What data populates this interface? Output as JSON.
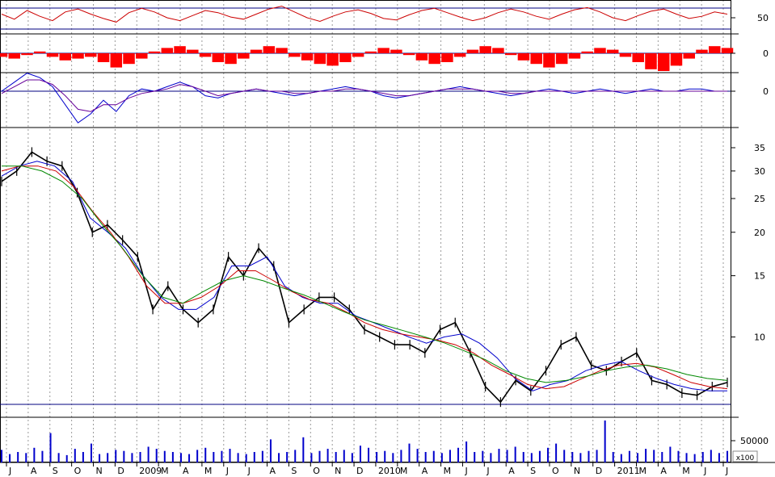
{
  "chart_data": {
    "type": "line",
    "panels": [
      {
        "name": "oscillator-rsi",
        "type": "line",
        "ticks": [
          "50"
        ],
        "series": [
          {
            "color": "#cc0000",
            "values": [
              55,
              48,
              60,
              52,
              46,
              58,
              62,
              55,
              49,
              44,
              57,
              63,
              58,
              50,
              46,
              53,
              60,
              57,
              51,
              48,
              55,
              62,
              66,
              58,
              50,
              45,
              52,
              58,
              61,
              56,
              49,
              47,
              54,
              60,
              63,
              57,
              51,
              46,
              50,
              57,
              62,
              58,
              52,
              48,
              55,
              61,
              64,
              58,
              50,
              46,
              53,
              59,
              62,
              55,
              49,
              52,
              58,
              55
            ]
          }
        ]
      },
      {
        "name": "oscillator-histogram",
        "type": "bar",
        "ticks": [
          "0"
        ],
        "series": [
          {
            "color": "#ff0000",
            "values": [
              -2,
              -3,
              -1,
              1,
              -2,
              -4,
              -3,
              -2,
              -5,
              -8,
              -6,
              -3,
              1,
              3,
              4,
              2,
              -2,
              -5,
              -6,
              -3,
              2,
              4,
              3,
              -2,
              -4,
              -6,
              -7,
              -5,
              -2,
              1,
              3,
              2,
              -1,
              -4,
              -6,
              -5,
              -2,
              2,
              4,
              3,
              -1,
              -4,
              -6,
              -8,
              -6,
              -3,
              1,
              3,
              2,
              -2,
              -5,
              -9,
              -10,
              -7,
              -3,
              2,
              4,
              3
            ]
          }
        ]
      },
      {
        "name": "oscillator-lines",
        "type": "line",
        "ticks": [
          "0"
        ],
        "series": [
          {
            "color": "#0000cc",
            "values": [
              0,
              4,
              8,
              6,
              2,
              -6,
              -14,
              -10,
              -4,
              -9,
              -2,
              1,
              0,
              2,
              4,
              2,
              -2,
              -3,
              -1,
              0,
              1,
              0,
              -1,
              -2,
              -1,
              0,
              1,
              2,
              1,
              0,
              -2,
              -3,
              -2,
              -1,
              0,
              1,
              2,
              1,
              0,
              -1,
              -2,
              -1,
              0,
              1,
              0,
              -1,
              0,
              1,
              0,
              -1,
              0,
              1,
              0,
              0,
              1,
              1,
              0,
              0
            ]
          },
          {
            "color": "#660099",
            "values": [
              -1,
              2,
              5,
              5,
              3,
              -2,
              -8,
              -9,
              -6,
              -6,
              -3,
              -1,
              0,
              1,
              3,
              2,
              0,
              -2,
              -1,
              0,
              1,
              0,
              0,
              -1,
              -1,
              0,
              0,
              1,
              1,
              0,
              -1,
              -2,
              -2,
              -1,
              0,
              1,
              1,
              1,
              0,
              0,
              -1,
              -1,
              0,
              0,
              0,
              0,
              0,
              0,
              0,
              0,
              0,
              0,
              0,
              0,
              0,
              0,
              0,
              0
            ]
          }
        ]
      },
      {
        "name": "price",
        "type": "line",
        "scale": "log",
        "ylim": [
          6.2,
          40
        ],
        "ticks": [
          "35",
          "30",
          "25",
          "20",
          "15",
          "10"
        ],
        "support_level": 6.4,
        "series": [
          {
            "color": "#000000",
            "name": "",
            "values": [
              28,
              30,
              34,
              32,
              31,
              26,
              20,
              21,
              19,
              17,
              12,
              14,
              12,
              11,
              12,
              17,
              15,
              18,
              16,
              11,
              12,
              13,
              13,
              12,
              10.5,
              10,
              9.5,
              9.5,
              9.0,
              10.5,
              11,
              9.0,
              7.2,
              6.5,
              7.5,
              7.0,
              8.0,
              9.5,
              10.0,
              8.3,
              8.0,
              8.5,
              9.0,
              7.5,
              7.3,
              6.9,
              6.8,
              7.2,
              7.4
            ]
          },
          {
            "color": "#0000cc",
            "name": "",
            "values": [
              29,
              31,
              32,
              31,
              28,
              22,
              20,
              18,
              15,
              13,
              12,
              12,
              13,
              16,
              16,
              17,
              14,
              13,
              12.5,
              12.5,
              11.5,
              11,
              10.5,
              10,
              9.6,
              10,
              10.2,
              9.6,
              8.7,
              7.6,
              7.0,
              7.3,
              7.5,
              8.0,
              8.3,
              8.5,
              8.0,
              7.6,
              7.3,
              7.1,
              7.0,
              7.0
            ]
          },
          {
            "color": "#cc0000",
            "name": "",
            "values": [
              30,
              31,
              31,
              30,
              27,
              23,
              20,
              17,
              14,
              12.5,
              12.5,
              13,
              14,
              15.5,
              15.5,
              14.5,
              13.5,
              12.8,
              12.5,
              11.8,
              11,
              10.5,
              10.2,
              10,
              9.8,
              9.5,
              9,
              8.3,
              7.8,
              7.3,
              7.1,
              7.2,
              7.6,
              8.0,
              8.3,
              8.4,
              8.2,
              7.8,
              7.4,
              7.2,
              7.1
            ]
          },
          {
            "color": "#008800",
            "name": "",
            "values": [
              31,
              31,
              30,
              28,
              25,
              21,
              18,
              15,
              13,
              12.5,
              13.5,
              14.5,
              15,
              14.5,
              13.8,
              13.2,
              12.5,
              11.8,
              11.2,
              10.8,
              10.4,
              10.0,
              9.6,
              9.1,
              8.6,
              8.0,
              7.6,
              7.4,
              7.5,
              7.7,
              8.0,
              8.2,
              8.3,
              8.1,
              7.8,
              7.6,
              7.5
            ]
          }
        ]
      },
      {
        "name": "volume",
        "type": "bar",
        "ticks": [
          "50000"
        ],
        "units_label": "x100",
        "series": [
          {
            "color": "#0000cc",
            "values": [
              12,
              8,
              10,
              9,
              14,
              11,
              28,
              9,
              7,
              13,
              10,
              18,
              8,
              9,
              12,
              11,
              9,
              10,
              15,
              13,
              11,
              10,
              9,
              8,
              12,
              14,
              10,
              11,
              13,
              9,
              8,
              10,
              11,
              22,
              9,
              10,
              12,
              24,
              9,
              11,
              13,
              10,
              12,
              9,
              16,
              14,
              10,
              11,
              9,
              12,
              18,
              13,
              10,
              11,
              9,
              12,
              14,
              20,
              10,
              11,
              9,
              13,
              12,
              15,
              10,
              9,
              11,
              14,
              18,
              12,
              10,
              9,
              11,
              12,
              40,
              10,
              8,
              11,
              9,
              13,
              12,
              10,
              15,
              11,
              9,
              8,
              10,
              12,
              9,
              11
            ]
          }
        ]
      }
    ],
    "x_labels": [
      "J",
      "A",
      "S",
      "O",
      "N",
      "D",
      "2009",
      "M",
      "A",
      "M",
      "J",
      "J",
      "A",
      "S",
      "O",
      "N",
      "D",
      "2010",
      "M",
      "A",
      "M",
      "J",
      "J",
      "A",
      "S",
      "O",
      "N",
      "D",
      "2011",
      "M",
      "A",
      "M",
      "J",
      "J"
    ]
  },
  "colors": {
    "grid": "#9a9a9a",
    "hline": "#000080",
    "frame": "#000000"
  }
}
